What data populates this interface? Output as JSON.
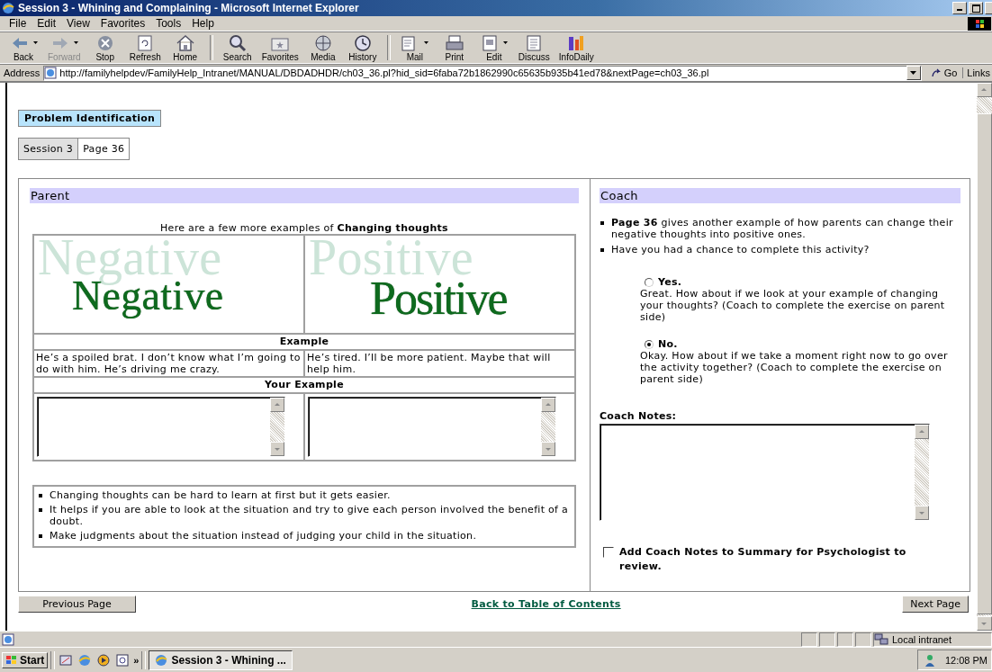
{
  "window": {
    "title": "Session 3 - Whining and Complaining - Microsoft Internet Explorer"
  },
  "menu": [
    "File",
    "Edit",
    "View",
    "Favorites",
    "Tools",
    "Help"
  ],
  "toolbar": [
    [
      {
        "label": "Back",
        "disabled": false,
        "dropdown": true
      },
      {
        "label": "Forward",
        "disabled": true,
        "dropdown": true
      },
      {
        "label": "Stop",
        "disabled": false,
        "dropdown": false
      },
      {
        "label": "Refresh",
        "disabled": false,
        "dropdown": false
      },
      {
        "label": "Home",
        "disabled": false,
        "dropdown": false
      }
    ],
    [
      {
        "label": "Search",
        "disabled": false,
        "dropdown": false
      },
      {
        "label": "Favorites",
        "disabled": false,
        "dropdown": false
      },
      {
        "label": "Media",
        "disabled": false,
        "dropdown": false
      },
      {
        "label": "History",
        "disabled": false,
        "dropdown": false
      }
    ],
    [
      {
        "label": "Mail",
        "disabled": false,
        "dropdown": true
      },
      {
        "label": "Print",
        "disabled": false,
        "dropdown": false
      },
      {
        "label": "Edit",
        "disabled": false,
        "dropdown": true
      },
      {
        "label": "Discuss",
        "disabled": false,
        "dropdown": false
      },
      {
        "label": "InfoDaily",
        "disabled": false,
        "dropdown": false
      }
    ]
  ],
  "address": {
    "label": "Address",
    "url": "http://familyhelpdev/FamilyHelp_Intranet/MANUAL/DBDADHDR/ch03_36.pl?hid_sid=6faba72b1862990c65635b935b41ed78&nextPage=ch03_36.pl",
    "go": "Go",
    "links": "Links"
  },
  "page": {
    "section": "Problem Identification",
    "breadcrumb": [
      {
        "label": "Session 3",
        "selected": false
      },
      {
        "label": "Page 36",
        "selected": true
      }
    ]
  },
  "parent": {
    "heading": "Parent",
    "intro": "Here are a few more examples of **Changing thoughts**",
    "pictures": [
      {
        "shadow": "Negative",
        "word": "Negative"
      },
      {
        "shadow": "Positive",
        "word": "Positive"
      }
    ],
    "example_heading": "Example",
    "examples": [
      "He’s a spoiled brat. I don’t know what I’m going to do with him. He’s driving me crazy.",
      "He’s tired. I’ll be more patient. Maybe that will help him."
    ],
    "your_example_heading": "Your Example",
    "answer_boxes": [
      {
        "kind": "textarea"
      },
      {
        "kind": "textarea"
      }
    ],
    "tips": [
      "Changing thoughts can be hard to learn at first but it gets easier.",
      "It helps if you are able to look at the situation and try to give each person involved the benefit of a doubt.",
      "Make judgments about the situation instead of judging your child in the situation."
    ]
  },
  "coach": {
    "heading": "Coach",
    "bullets": [
      "**Page 36** gives another example of how parents can change their negative thoughts into positive ones.",
      "Have you had a chance to complete this activity?"
    ],
    "options": [
      {
        "label": "Yes.",
        "text": "Great. How about if we look at your example of changing your thoughts? (Coach to complete the exercise on parent side)",
        "selected": false
      },
      {
        "label": "No.",
        "text": "Okay. How about if we take a moment right now to go over the activity together? (Coach to complete the exercise on parent side)",
        "selected": true
      }
    ],
    "notes_label": "Coach Notes:",
    "checkbox": {
      "label": "Add Coach Notes to Summary for Psychologist to review.",
      "checked": false
    }
  },
  "navigation": {
    "previous": "Previous Page",
    "contents_link": "Back to Table of Contents",
    "next": "Next Page"
  },
  "status_bar": {
    "zone": "Local intranet"
  },
  "taskbar": {
    "start": "Start",
    "more": "»",
    "tasks": [
      {
        "label": "Session 3 - Whining ...",
        "selected": true
      }
    ],
    "clock": "12:08 PM"
  }
}
